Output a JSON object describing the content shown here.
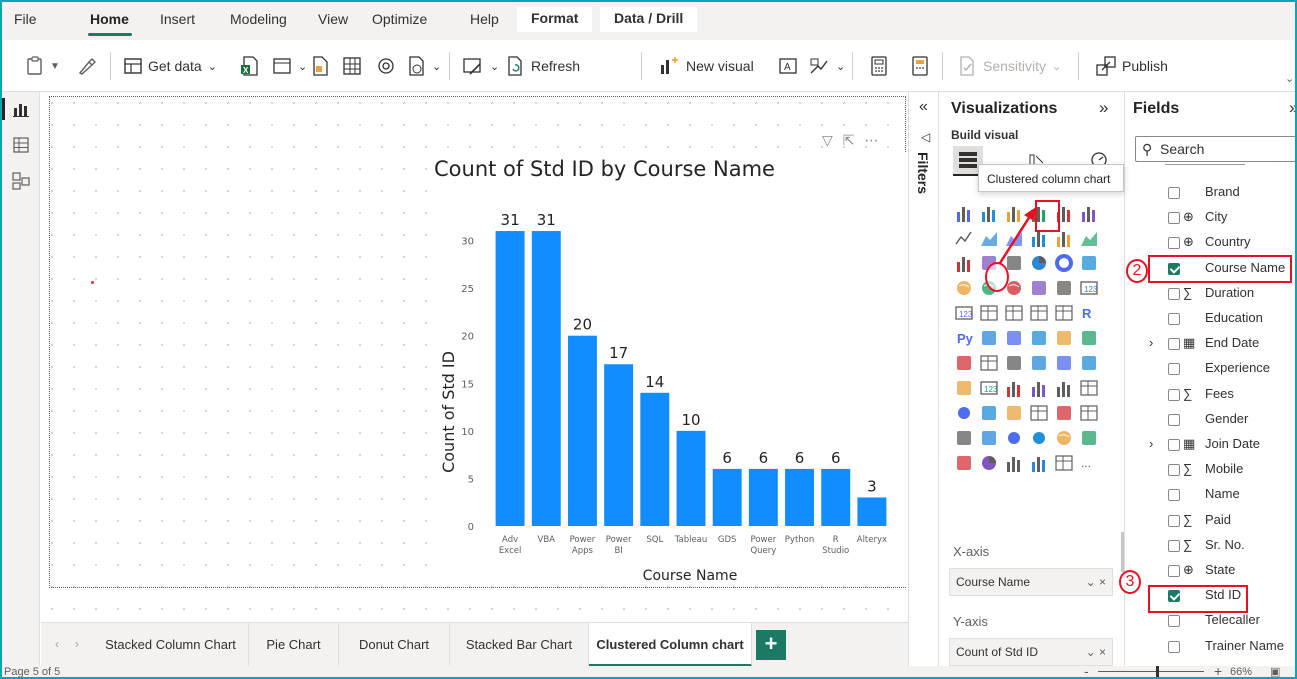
{
  "menu": {
    "items": [
      "File",
      "Home",
      "Insert",
      "Modeling",
      "View",
      "Optimize",
      "Help"
    ],
    "context_tabs": [
      "Format",
      "Data / Drill"
    ],
    "active": "Home"
  },
  "ribbon": {
    "get_data": "Get data",
    "refresh": "Refresh",
    "new_visual": "New visual",
    "sensitivity": "Sensitivity",
    "publish": "Publish"
  },
  "chart_data": {
    "type": "bar",
    "title": "Count of Std ID by Course Name",
    "xlabel": "Course Name",
    "ylabel": "Count of Std ID",
    "categories": [
      "Adv Excel",
      "VBA",
      "Power Apps",
      "Power BI",
      "SQL",
      "Tableau",
      "GDS",
      "Power Query",
      "Python",
      "R Studio",
      "Alteryx"
    ],
    "category_lines": [
      [
        "Adv",
        "Excel"
      ],
      [
        "VBA"
      ],
      [
        "Power",
        "Apps"
      ],
      [
        "Power",
        "BI"
      ],
      [
        "SQL"
      ],
      [
        "Tableau"
      ],
      [
        "GDS"
      ],
      [
        "Power",
        "Query"
      ],
      [
        "Python"
      ],
      [
        "R",
        "Studio"
      ],
      [
        "Alteryx"
      ]
    ],
    "values": [
      31,
      31,
      20,
      17,
      14,
      10,
      6,
      6,
      6,
      6,
      3
    ],
    "yticks": [
      "0",
      "5",
      "10",
      "15",
      "20",
      "25",
      "30"
    ],
    "ylim": [
      0,
      33
    ],
    "bar_color": "#118dff",
    "data_labels": true,
    "grid": false
  },
  "filters": {
    "label": "Filters"
  },
  "viz": {
    "title": "Visualizations",
    "build_visual": "Build visual",
    "tooltip": "Clustered column chart",
    "x_axis_label": "X-axis",
    "x_axis_value": "Course Name",
    "y_axis_label": "Y-axis",
    "y_axis_value": "Count of Std ID",
    "more": "..."
  },
  "fields": {
    "title": "Fields",
    "search_placeholder": "Search",
    "items": [
      {
        "name": "Brand",
        "type": "",
        "checked": false,
        "expand": false
      },
      {
        "name": "City",
        "type": "globe",
        "checked": false,
        "expand": false
      },
      {
        "name": "Country",
        "type": "globe",
        "checked": false,
        "expand": false
      },
      {
        "name": "Course Name",
        "type": "",
        "checked": true,
        "expand": false
      },
      {
        "name": "Duration",
        "type": "sigma",
        "checked": false,
        "expand": false
      },
      {
        "name": "Education",
        "type": "",
        "checked": false,
        "expand": false
      },
      {
        "name": "End Date",
        "type": "calendar",
        "checked": false,
        "expand": true
      },
      {
        "name": "Experience",
        "type": "",
        "checked": false,
        "expand": false
      },
      {
        "name": "Fees",
        "type": "sigma",
        "checked": false,
        "expand": false
      },
      {
        "name": "Gender",
        "type": "",
        "checked": false,
        "expand": false
      },
      {
        "name": "Join Date",
        "type": "calendar",
        "checked": false,
        "expand": true
      },
      {
        "name": "Mobile",
        "type": "sigma",
        "checked": false,
        "expand": false
      },
      {
        "name": "Name",
        "type": "",
        "checked": false,
        "expand": false
      },
      {
        "name": "Paid",
        "type": "sigma",
        "checked": false,
        "expand": false
      },
      {
        "name": "Sr. No.",
        "type": "sigma",
        "checked": false,
        "expand": false
      },
      {
        "name": "State",
        "type": "globe",
        "checked": false,
        "expand": false
      },
      {
        "name": "Std ID",
        "type": "",
        "checked": true,
        "expand": false
      },
      {
        "name": "Telecaller",
        "type": "",
        "checked": false,
        "expand": false
      },
      {
        "name": "Trainer Name",
        "type": "",
        "checked": false,
        "expand": false
      }
    ]
  },
  "tabs": {
    "items": [
      "Stacked Column Chart",
      "Pie Chart",
      "Donut Chart",
      "Stacked Bar Chart",
      "Clustered Column chart"
    ],
    "active": "Clustered Column chart",
    "add": "+"
  },
  "status": {
    "page": "Page 5 of 5",
    "zoom": "66%"
  },
  "annotations": [
    "2",
    "3"
  ],
  "colors": {
    "accent": "#1a7a64",
    "annotation": "#e81123",
    "bar": "#118dff"
  }
}
